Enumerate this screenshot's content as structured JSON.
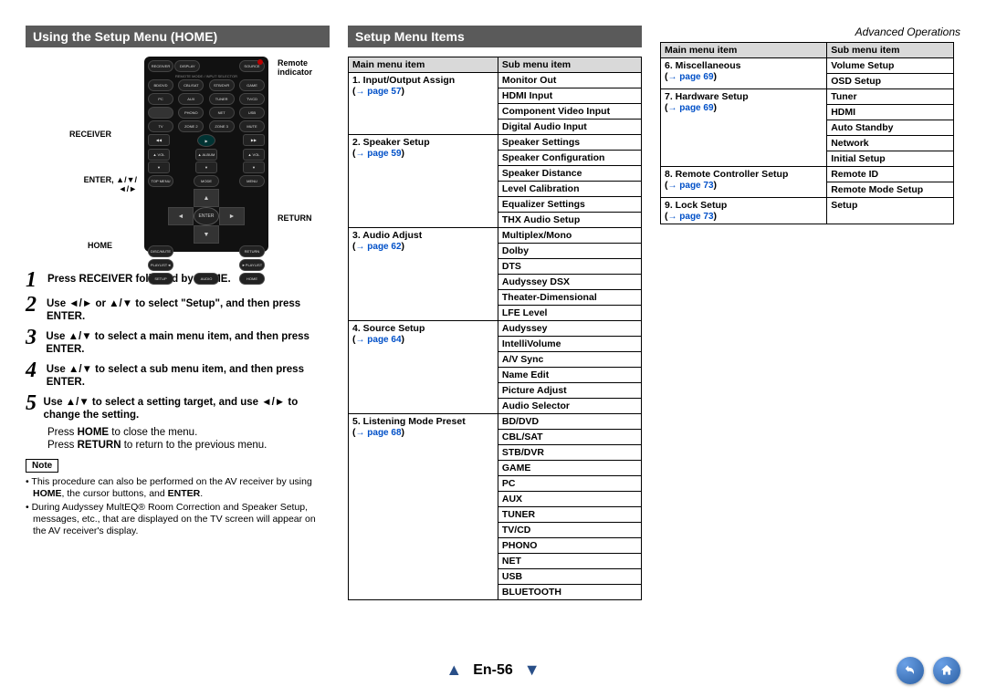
{
  "header_right": "Advanced Operations",
  "section1_title": "Using the Setup Menu (HOME)",
  "section2_title": "Setup Menu Items",
  "remote": {
    "indicator_label": "Remote indicator",
    "labels": {
      "receiver": "RECEIVER",
      "enter": "ENTER, ▲/▼/◄/►",
      "home": "HOME",
      "return": "RETURN"
    }
  },
  "steps": [
    {
      "num": "1",
      "text": "Press RECEIVER followed by HOME."
    },
    {
      "num": "2",
      "text": "Use ◄/► or ▲/▼ to select \"Setup\", and then press ENTER."
    },
    {
      "num": "3",
      "text": "Use ▲/▼ to select a main menu item, and then press ENTER."
    },
    {
      "num": "4",
      "text": "Use ▲/▼ to select a sub menu item, and then press ENTER."
    },
    {
      "num": "5",
      "text": "Use ▲/▼ to select a setting target, and use ◄/► to change the setting."
    }
  ],
  "step_after": {
    "line1_pre": "Press ",
    "line1_bold": "HOME",
    "line1_post": " to close the menu.",
    "line2_pre": "Press ",
    "line2_bold": "RETURN",
    "line2_post": " to return to the previous menu."
  },
  "note_label": "Note",
  "notes": [
    "This procedure can also be performed on the AV receiver by using HOME, the cursor buttons, and ENTER.",
    "During Audyssey MultEQ® Room Correction and Speaker Setup, messages, etc., that are displayed on the TV screen will appear on the AV receiver's display."
  ],
  "notes_bold_map": {
    "HOME": true,
    "ENTER": true
  },
  "table_header": {
    "main": "Main menu item",
    "sub": "Sub menu item"
  },
  "left_table": [
    {
      "main": "1. Input/Output Assign",
      "page": "page 57",
      "subs": [
        "Monitor Out",
        "HDMI Input",
        "Component Video Input",
        "Digital Audio Input"
      ]
    },
    {
      "main": "2. Speaker Setup",
      "page": "page 59",
      "subs": [
        "Speaker Settings",
        "Speaker Configuration",
        "Speaker Distance",
        "Level Calibration",
        "Equalizer Settings",
        "THX Audio Setup"
      ]
    },
    {
      "main": "3. Audio Adjust",
      "page": "page 62",
      "subs": [
        "Multiplex/Mono",
        "Dolby",
        "DTS",
        "Audyssey DSX",
        "Theater-Dimensional",
        "LFE Level"
      ]
    },
    {
      "main": "4. Source Setup",
      "page": "page 64",
      "subs": [
        "Audyssey",
        "IntelliVolume",
        "A/V Sync",
        "Name Edit",
        "Picture Adjust",
        "Audio Selector"
      ]
    },
    {
      "main": "5. Listening Mode Preset",
      "page": "page 68",
      "subs": [
        "BD/DVD",
        "CBL/SAT",
        "STB/DVR",
        "GAME",
        "PC",
        "AUX",
        "TUNER",
        "TV/CD",
        "PHONO",
        "NET",
        "USB",
        "BLUETOOTH"
      ]
    }
  ],
  "right_table": [
    {
      "main": "6. Miscellaneous",
      "page": "page 69",
      "subs": [
        "Volume Setup",
        "OSD Setup"
      ]
    },
    {
      "main": "7. Hardware Setup",
      "page": "page 69",
      "subs": [
        "Tuner",
        "HDMI",
        "Auto Standby",
        "Network",
        "Initial Setup"
      ]
    },
    {
      "main": "8. Remote Controller Setup",
      "page": "page 73",
      "subs": [
        "Remote ID",
        "Remote Mode Setup"
      ]
    },
    {
      "main": "9. Lock Setup",
      "page": "page 73",
      "subs": [
        "Setup"
      ]
    }
  ],
  "page_no": "En-56"
}
